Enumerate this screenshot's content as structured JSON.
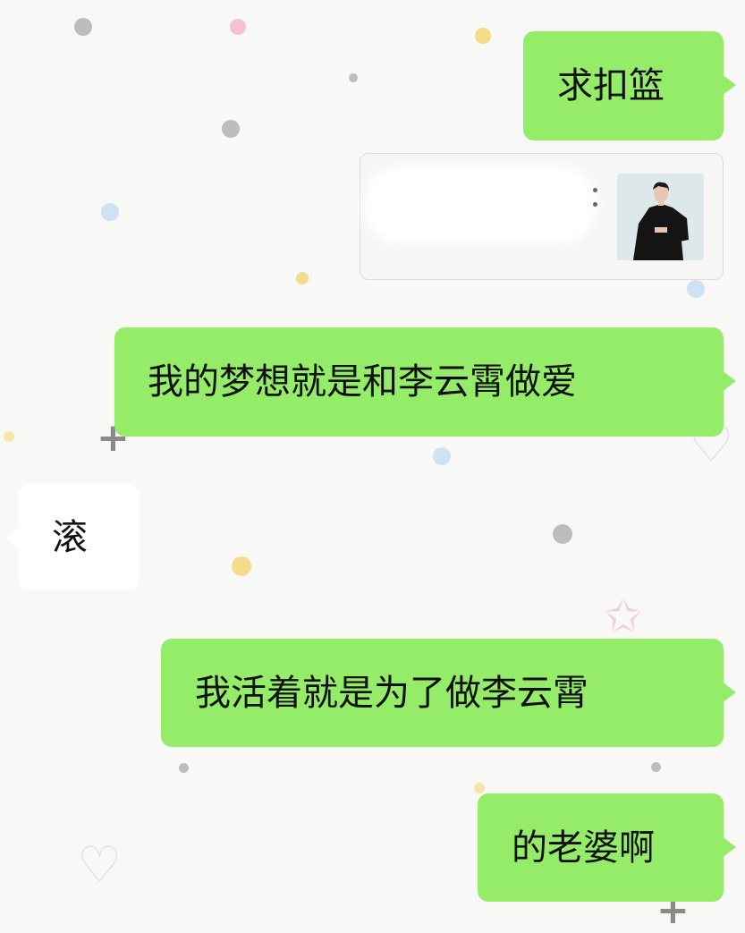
{
  "chat": {
    "messages": [
      {
        "side": "right",
        "text": "求扣篮"
      },
      {
        "side": "right",
        "type": "shared-card",
        "thumbnail": "woman-black-outfit-photo"
      },
      {
        "side": "right",
        "text": "我的梦想就是和李云霄做爱"
      },
      {
        "side": "left",
        "text": "滚"
      },
      {
        "side": "right",
        "text": "我活着就是为了做李云霄"
      },
      {
        "side": "right",
        "text": "的老婆啊"
      }
    ]
  },
  "colors": {
    "sent_bubble": "#95ec69",
    "received_bubble": "#ffffff",
    "background": "#f8f8f6"
  }
}
